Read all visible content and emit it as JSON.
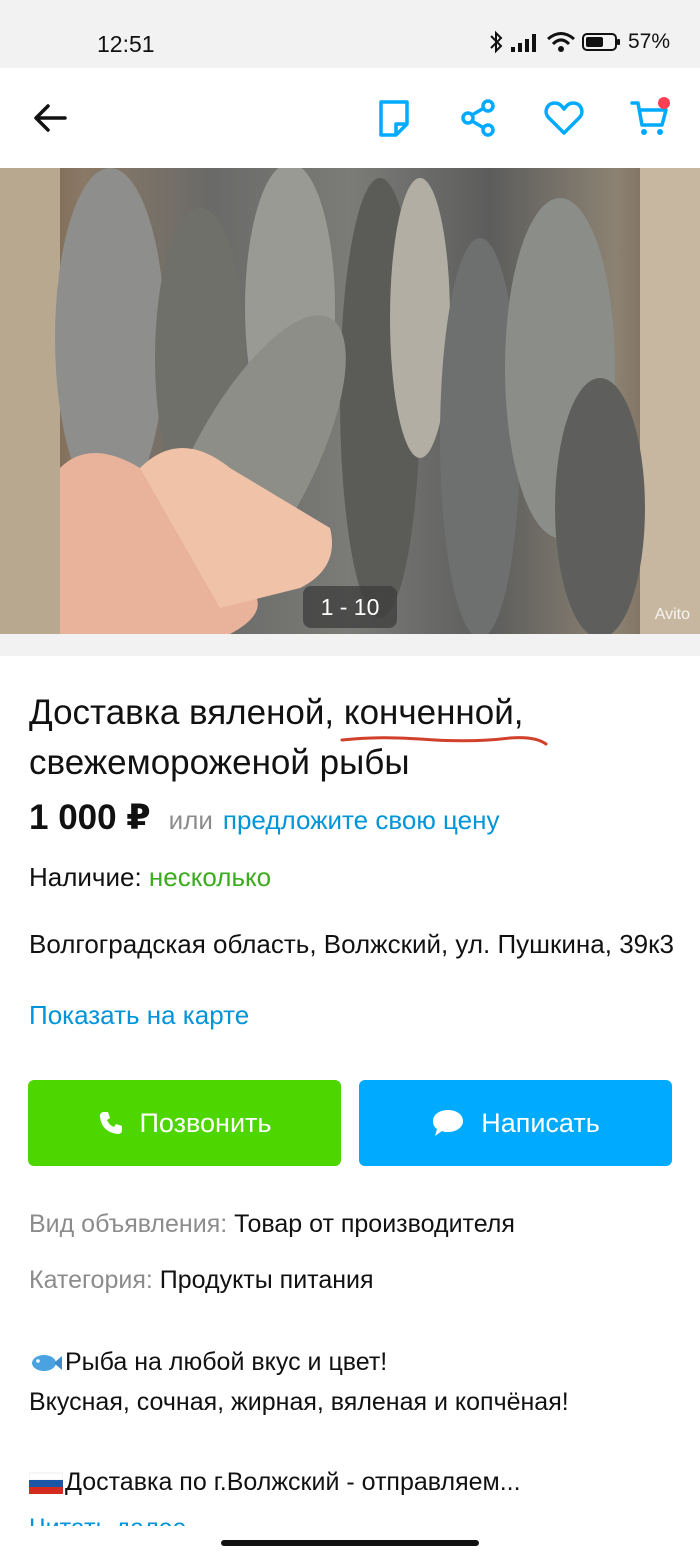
{
  "status": {
    "time": "12:51",
    "battery": "57%"
  },
  "gallery": {
    "counter": "1 - 10",
    "watermark": "Avito"
  },
  "listing": {
    "title_part1": "Доставка вяленой, ",
    "title_underlined": "конченной",
    "title_part2": ", свежемороженой рыбы",
    "price": "1 000 ₽",
    "price_or": "или",
    "price_offer": "предложите свою цену",
    "availability_label": "Наличие: ",
    "availability_value": "несколько",
    "address": "Волгоградская область, Волжский, ул. Пушкина, 39к3",
    "map_link": "Показать на карте"
  },
  "actions": {
    "call": "Позвонить",
    "message": "Написать"
  },
  "params": [
    {
      "label": "Вид объявления: ",
      "value": "Товар от производителя"
    },
    {
      "label": "Категория: ",
      "value": "Продукты питания"
    }
  ],
  "description": {
    "line1": "Рыба на любой вкус и цвет!",
    "line2": "Вкусная, сочная, жирная, вяленая и копчёная!",
    "line3": "Доставка по г.Волжский - отправляем...",
    "read_more": "Читать далее"
  },
  "colors": {
    "green": "#4ed600",
    "blue": "#00aaff",
    "link": "#0094d9",
    "availability": "#3bac1d",
    "underline": "#d0402a"
  }
}
